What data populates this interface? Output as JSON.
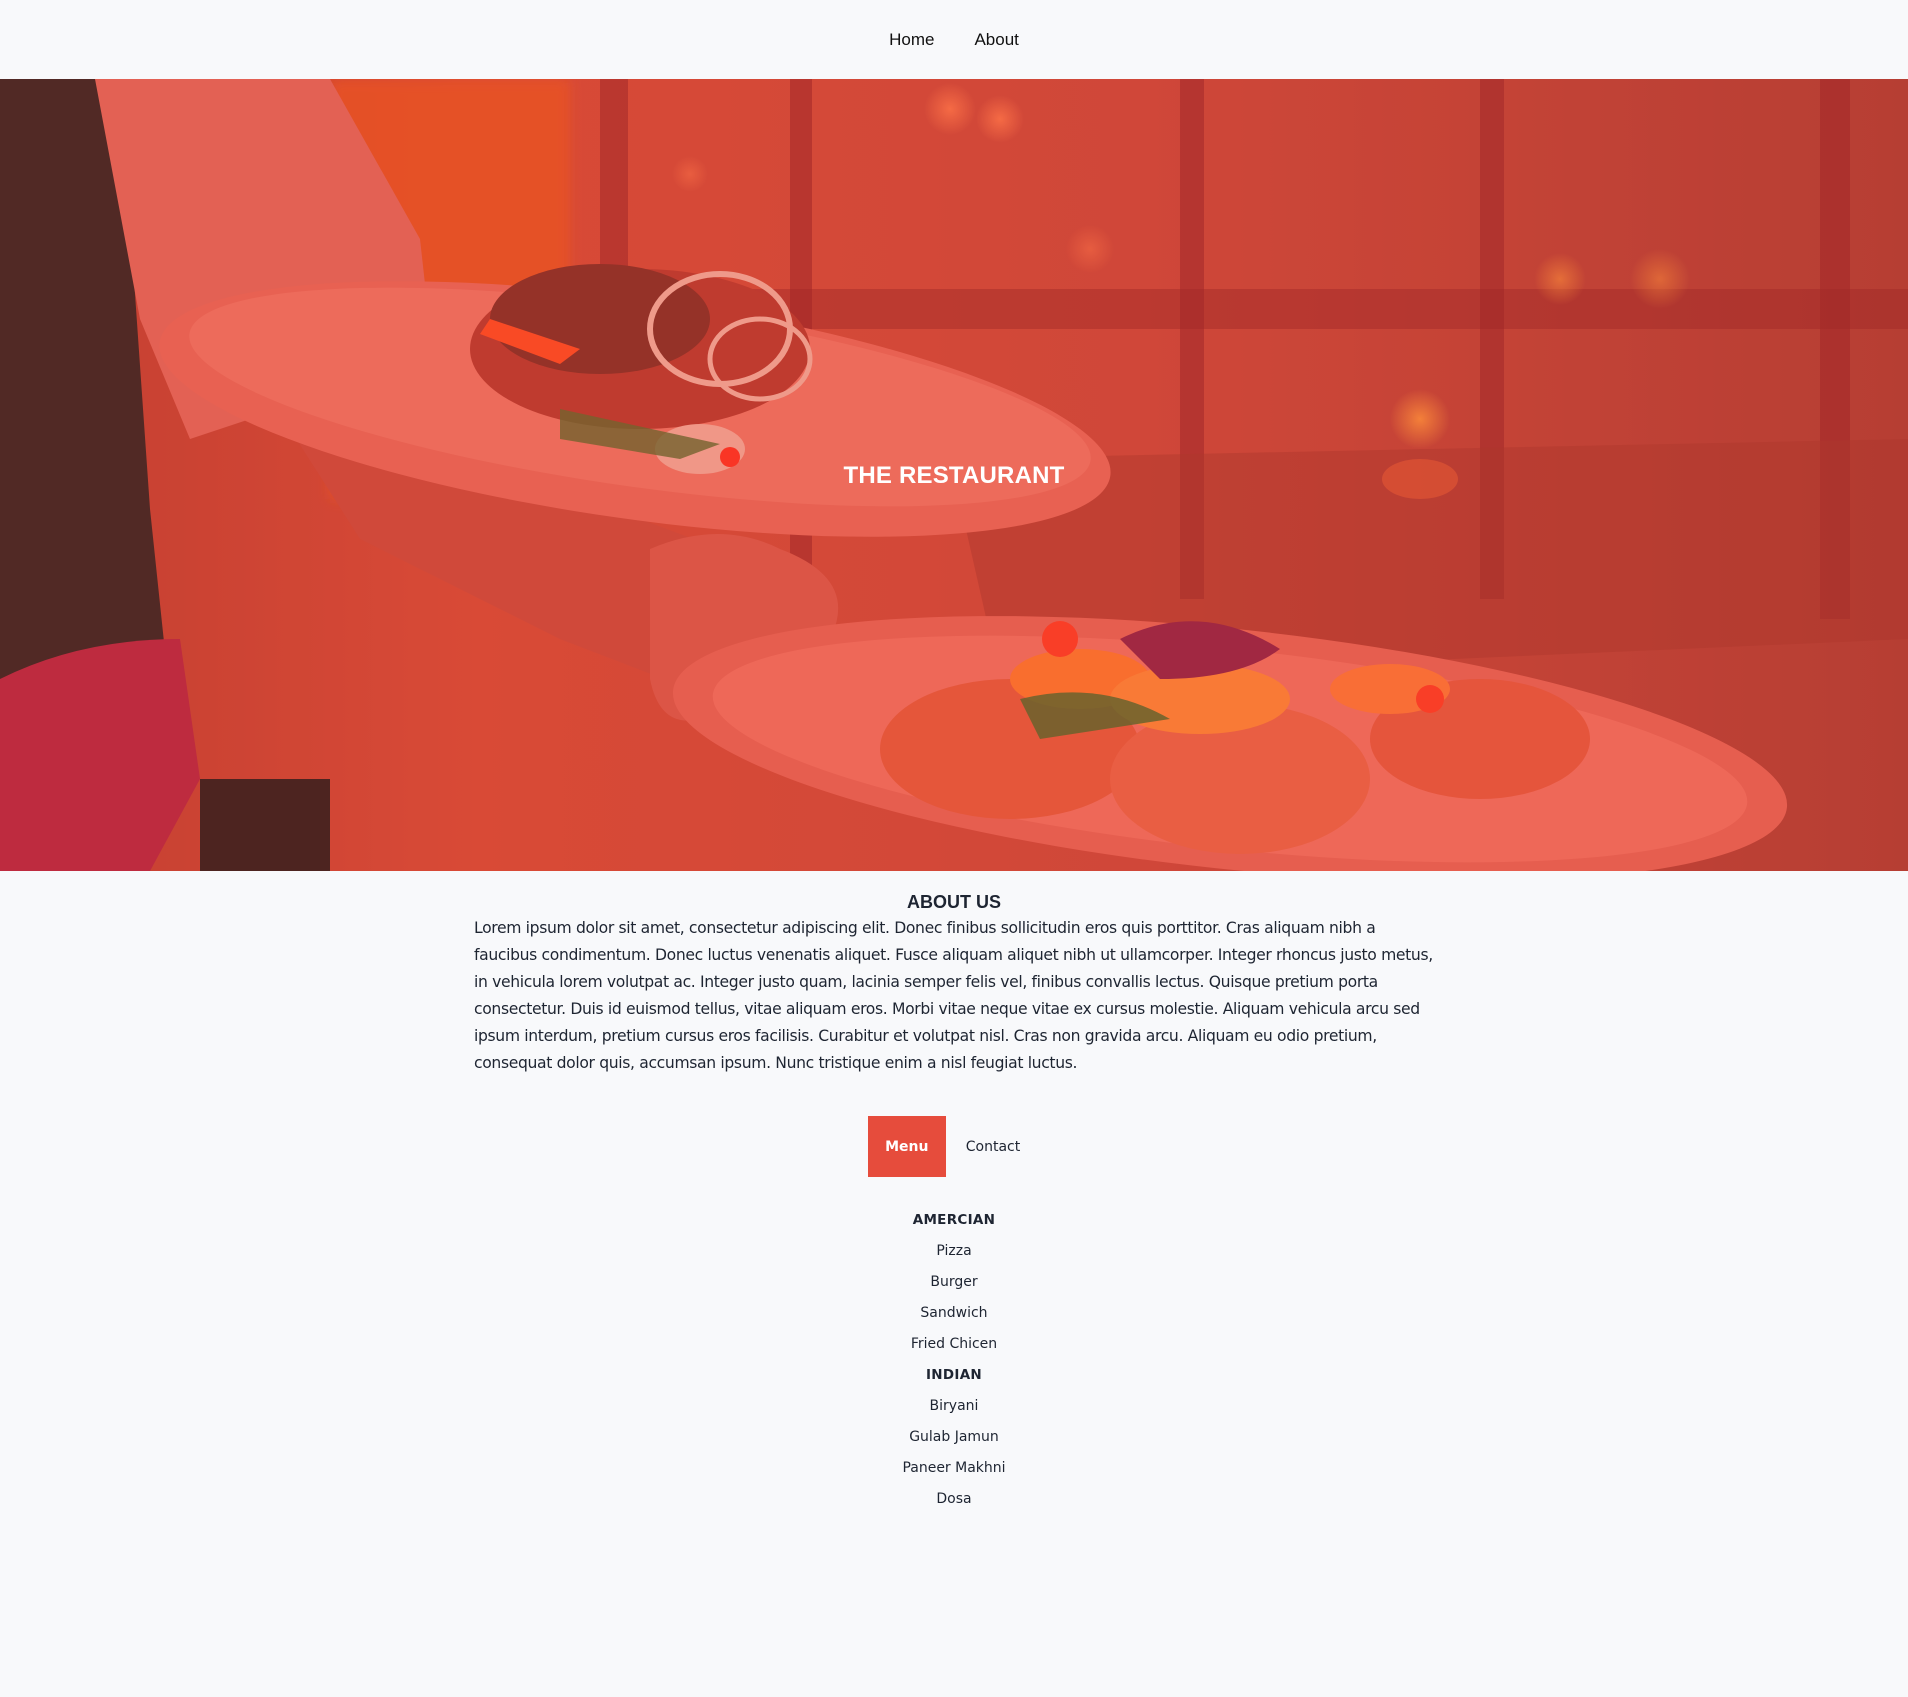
{
  "nav": {
    "items": [
      {
        "label": "Home"
      },
      {
        "label": "About"
      }
    ]
  },
  "hero": {
    "title": "THE RESTAURANT",
    "overlay_color": "#e64c3c"
  },
  "about": {
    "title": "ABOUT US",
    "text": "Lorem ipsum dolor sit amet, consectetur adipiscing elit. Donec finibus sollicitudin eros quis porttitor. Cras aliquam nibh a faucibus condimentum. Donec luctus venenatis aliquet. Fusce aliquam aliquet nibh ut ullamcorper. Integer rhoncus justo metus, in vehicula lorem volutpat ac. Integer justo quam, lacinia semper felis vel, finibus convallis lectus. Quisque pretium porta consectetur. Duis id euismod tellus, vitae aliquam eros. Morbi vitae neque vitae ex cursus molestie. Aliquam vehicula arcu sed ipsum interdum, pretium cursus eros facilisis. Curabitur et volutpat nisl. Cras non gravida arcu. Aliquam eu odio pretium, consequat dolor quis, accumsan ipsum. Nunc tristique enim a nisl feugiat luctus."
  },
  "tabs": [
    {
      "label": "Menu",
      "active": true
    },
    {
      "label": "Contact",
      "active": false
    }
  ],
  "menu": {
    "american": {
      "title": "AMERCIAN",
      "items": [
        "Pizza",
        "Burger",
        "Sandwich",
        "Fried Chicen"
      ]
    },
    "indian": {
      "title": "INDIAN",
      "items": [
        "Biryani",
        "Gulab Jamun",
        "Paneer Makhni",
        "Dosa"
      ]
    }
  },
  "colors": {
    "accent": "#e64c3c",
    "background": "#f8f9fb",
    "text": "#1e2532"
  }
}
